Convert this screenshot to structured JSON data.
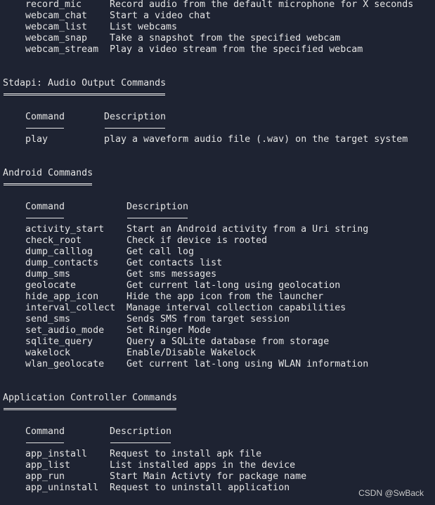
{
  "terminal": {
    "leading_rows": [
      [
        "record_mic",
        "Record audio from the default microphone for X seconds"
      ],
      [
        "webcam_chat",
        "Start a video chat"
      ],
      [
        "webcam_list",
        "List webcams"
      ],
      [
        "webcam_snap",
        "Take a snapshot from the specified webcam"
      ],
      [
        "webcam_stream",
        "Play a video stream from the specified webcam"
      ]
    ],
    "leading_desc_col": 19,
    "sections": [
      {
        "title": "Stdapi: Audio Output Commands",
        "headers": [
          "Command",
          "Description"
        ],
        "desc_col": 18,
        "rows": [
          [
            "play",
            "play a waveform audio file (.wav) on the target system"
          ]
        ]
      },
      {
        "title": "Android Commands",
        "headers": [
          "Command",
          "Description"
        ],
        "desc_col": 22,
        "rows": [
          [
            "activity_start",
            "Start an Android activity from a Uri string"
          ],
          [
            "check_root",
            "Check if device is rooted"
          ],
          [
            "dump_calllog",
            "Get call log"
          ],
          [
            "dump_contacts",
            "Get contacts list"
          ],
          [
            "dump_sms",
            "Get sms messages"
          ],
          [
            "geolocate",
            "Get current lat-long using geolocation"
          ],
          [
            "hide_app_icon",
            "Hide the app icon from the launcher"
          ],
          [
            "interval_collect",
            "Manage interval collection capabilities"
          ],
          [
            "send_sms",
            "Sends SMS from target session"
          ],
          [
            "set_audio_mode",
            "Set Ringer Mode"
          ],
          [
            "sqlite_query",
            "Query a SQLite database from storage"
          ],
          [
            "wakelock",
            "Enable/Disable Wakelock"
          ],
          [
            "wlan_geolocate",
            "Get current lat-long using WLAN information"
          ]
        ]
      },
      {
        "title": "Application Controller Commands",
        "headers": [
          "Command",
          "Description"
        ],
        "desc_col": 19,
        "rows": [
          [
            "app_install",
            "Request to install apk file"
          ],
          [
            "app_list",
            "List installed apps in the device"
          ],
          [
            "app_run",
            "Start Main Activty for package name"
          ],
          [
            "app_uninstall",
            "Request to uninstall application"
          ]
        ]
      }
    ]
  },
  "watermark": "CSDN @SwBack"
}
